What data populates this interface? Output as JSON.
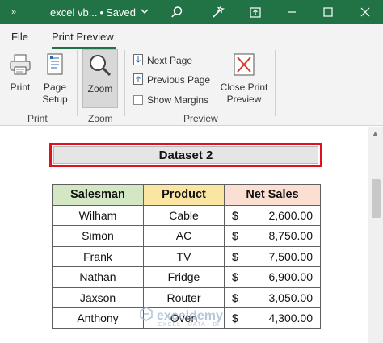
{
  "titlebar": {
    "qa_label": "»",
    "filename": "excel vb...",
    "separator": "•",
    "status": "Saved",
    "icons": [
      "search-icon",
      "magic-wand-icon",
      "restore-ribbon-icon",
      "minimize-icon",
      "maximize-icon",
      "close-icon"
    ],
    "bg": "#217346"
  },
  "ribbon": {
    "tabs": [
      "File",
      "Print Preview"
    ],
    "print": {
      "label": "Print",
      "group": "Print"
    },
    "page_setup": {
      "line1": "Page",
      "line2": "Setup"
    },
    "zoom": {
      "label": "Zoom",
      "group": "Zoom"
    },
    "next_page": "Next Page",
    "previous_page": "Previous Page",
    "show_margins": "Show Margins",
    "close_print": {
      "line1": "Close Print",
      "line2": "Preview"
    },
    "preview_group": "Preview"
  },
  "sheet": {
    "dataset_title": "Dataset 2",
    "headers": [
      "Salesman",
      "Product",
      "Net Sales"
    ],
    "rows": [
      {
        "salesman": "Wilham",
        "product": "Cable",
        "currency": "$",
        "amount": "2,600.00"
      },
      {
        "salesman": "Simon",
        "product": "AC",
        "currency": "$",
        "amount": "8,750.00"
      },
      {
        "salesman": "Frank",
        "product": "TV",
        "currency": "$",
        "amount": "7,500.00"
      },
      {
        "salesman": "Nathan",
        "product": "Fridge",
        "currency": "$",
        "amount": "6,900.00"
      },
      {
        "salesman": "Jaxson",
        "product": "Router",
        "currency": "$",
        "amount": "3,050.00"
      },
      {
        "salesman": "Anthony",
        "product": "Oven",
        "currency": "$",
        "amount": "4,300.00"
      }
    ],
    "header_colors": [
      "#d4e7c5",
      "#fbe5a3",
      "#fadfd2"
    ]
  },
  "watermark": {
    "text": "exceldemy",
    "sub": "EXCEL · DATA · BI"
  }
}
